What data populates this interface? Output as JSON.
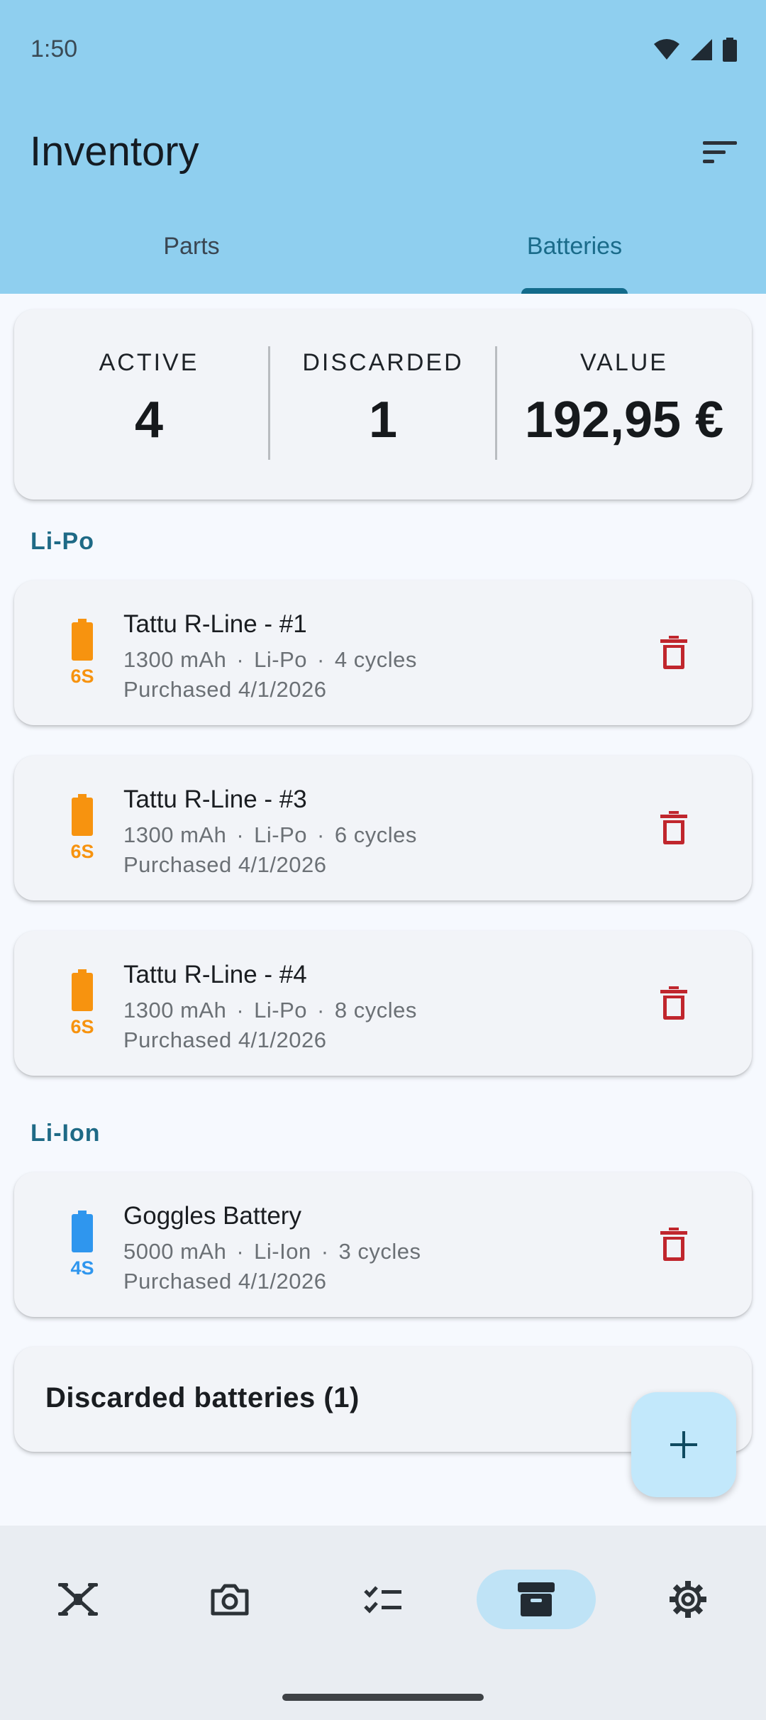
{
  "status": {
    "time": "1:50"
  },
  "header": {
    "title": "Inventory"
  },
  "tabs": [
    {
      "label": "Parts",
      "active": false
    },
    {
      "label": "Batteries",
      "active": true
    }
  ],
  "summary": {
    "active_label": "ACTIVE",
    "active_value": "4",
    "discarded_label": "DISCARDED",
    "discarded_value": "1",
    "value_label": "VALUE",
    "value_value": "192,95 €"
  },
  "sections": [
    {
      "title": "Li-Po",
      "items": [
        {
          "name": "Tattu R-Line - #1",
          "capacity": "1300 mAh",
          "chemistry": "Li-Po",
          "cycles": "4 cycles",
          "purchased": "Purchased 4/1/2026",
          "cells": "6S",
          "color": "#f7930f"
        },
        {
          "name": "Tattu R-Line - #3",
          "capacity": "1300 mAh",
          "chemistry": "Li-Po",
          "cycles": "6 cycles",
          "purchased": "Purchased 4/1/2026",
          "cells": "6S",
          "color": "#f7930f"
        },
        {
          "name": "Tattu R-Line - #4",
          "capacity": "1300 mAh",
          "chemistry": "Li-Po",
          "cycles": "8 cycles",
          "purchased": "Purchased 4/1/2026",
          "cells": "6S",
          "color": "#f7930f"
        }
      ]
    },
    {
      "title": "Li-Ion",
      "items": [
        {
          "name": "Goggles Battery",
          "capacity": "5000 mAh",
          "chemistry": "Li-Ion",
          "cycles": "3 cycles",
          "purchased": "Purchased 4/1/2026",
          "cells": "4S",
          "color": "#2f96ee"
        }
      ]
    }
  ],
  "discarded": {
    "label": "Discarded batteries (1)"
  },
  "meta_separator": "·",
  "nav": [
    {
      "icon": "drone-icon",
      "active": false
    },
    {
      "icon": "camera-icon",
      "active": false
    },
    {
      "icon": "checklist-icon",
      "active": false
    },
    {
      "icon": "archive-icon",
      "active": true
    },
    {
      "icon": "settings-icon",
      "active": false
    }
  ],
  "colors": {
    "appbar": "#8fcfef",
    "accent": "#136b8b",
    "delete": "#c0262d",
    "lipo": "#f7930f",
    "liion": "#2f96ee"
  }
}
